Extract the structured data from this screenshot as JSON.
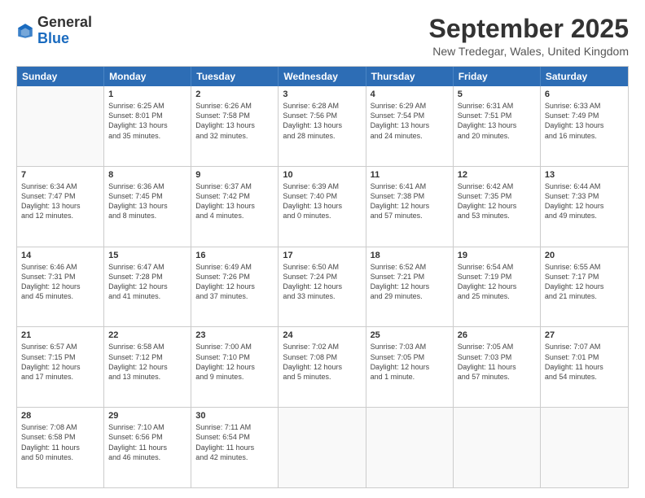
{
  "header": {
    "logo_general": "General",
    "logo_blue": "Blue",
    "month_title": "September 2025",
    "location": "New Tredegar, Wales, United Kingdom"
  },
  "calendar": {
    "days_of_week": [
      "Sunday",
      "Monday",
      "Tuesday",
      "Wednesday",
      "Thursday",
      "Friday",
      "Saturday"
    ],
    "rows": [
      [
        {
          "day": "",
          "lines": []
        },
        {
          "day": "1",
          "lines": [
            "Sunrise: 6:25 AM",
            "Sunset: 8:01 PM",
            "Daylight: 13 hours",
            "and 35 minutes."
          ]
        },
        {
          "day": "2",
          "lines": [
            "Sunrise: 6:26 AM",
            "Sunset: 7:58 PM",
            "Daylight: 13 hours",
            "and 32 minutes."
          ]
        },
        {
          "day": "3",
          "lines": [
            "Sunrise: 6:28 AM",
            "Sunset: 7:56 PM",
            "Daylight: 13 hours",
            "and 28 minutes."
          ]
        },
        {
          "day": "4",
          "lines": [
            "Sunrise: 6:29 AM",
            "Sunset: 7:54 PM",
            "Daylight: 13 hours",
            "and 24 minutes."
          ]
        },
        {
          "day": "5",
          "lines": [
            "Sunrise: 6:31 AM",
            "Sunset: 7:51 PM",
            "Daylight: 13 hours",
            "and 20 minutes."
          ]
        },
        {
          "day": "6",
          "lines": [
            "Sunrise: 6:33 AM",
            "Sunset: 7:49 PM",
            "Daylight: 13 hours",
            "and 16 minutes."
          ]
        }
      ],
      [
        {
          "day": "7",
          "lines": [
            "Sunrise: 6:34 AM",
            "Sunset: 7:47 PM",
            "Daylight: 13 hours",
            "and 12 minutes."
          ]
        },
        {
          "day": "8",
          "lines": [
            "Sunrise: 6:36 AM",
            "Sunset: 7:45 PM",
            "Daylight: 13 hours",
            "and 8 minutes."
          ]
        },
        {
          "day": "9",
          "lines": [
            "Sunrise: 6:37 AM",
            "Sunset: 7:42 PM",
            "Daylight: 13 hours",
            "and 4 minutes."
          ]
        },
        {
          "day": "10",
          "lines": [
            "Sunrise: 6:39 AM",
            "Sunset: 7:40 PM",
            "Daylight: 13 hours",
            "and 0 minutes."
          ]
        },
        {
          "day": "11",
          "lines": [
            "Sunrise: 6:41 AM",
            "Sunset: 7:38 PM",
            "Daylight: 12 hours",
            "and 57 minutes."
          ]
        },
        {
          "day": "12",
          "lines": [
            "Sunrise: 6:42 AM",
            "Sunset: 7:35 PM",
            "Daylight: 12 hours",
            "and 53 minutes."
          ]
        },
        {
          "day": "13",
          "lines": [
            "Sunrise: 6:44 AM",
            "Sunset: 7:33 PM",
            "Daylight: 12 hours",
            "and 49 minutes."
          ]
        }
      ],
      [
        {
          "day": "14",
          "lines": [
            "Sunrise: 6:46 AM",
            "Sunset: 7:31 PM",
            "Daylight: 12 hours",
            "and 45 minutes."
          ]
        },
        {
          "day": "15",
          "lines": [
            "Sunrise: 6:47 AM",
            "Sunset: 7:28 PM",
            "Daylight: 12 hours",
            "and 41 minutes."
          ]
        },
        {
          "day": "16",
          "lines": [
            "Sunrise: 6:49 AM",
            "Sunset: 7:26 PM",
            "Daylight: 12 hours",
            "and 37 minutes."
          ]
        },
        {
          "day": "17",
          "lines": [
            "Sunrise: 6:50 AM",
            "Sunset: 7:24 PM",
            "Daylight: 12 hours",
            "and 33 minutes."
          ]
        },
        {
          "day": "18",
          "lines": [
            "Sunrise: 6:52 AM",
            "Sunset: 7:21 PM",
            "Daylight: 12 hours",
            "and 29 minutes."
          ]
        },
        {
          "day": "19",
          "lines": [
            "Sunrise: 6:54 AM",
            "Sunset: 7:19 PM",
            "Daylight: 12 hours",
            "and 25 minutes."
          ]
        },
        {
          "day": "20",
          "lines": [
            "Sunrise: 6:55 AM",
            "Sunset: 7:17 PM",
            "Daylight: 12 hours",
            "and 21 minutes."
          ]
        }
      ],
      [
        {
          "day": "21",
          "lines": [
            "Sunrise: 6:57 AM",
            "Sunset: 7:15 PM",
            "Daylight: 12 hours",
            "and 17 minutes."
          ]
        },
        {
          "day": "22",
          "lines": [
            "Sunrise: 6:58 AM",
            "Sunset: 7:12 PM",
            "Daylight: 12 hours",
            "and 13 minutes."
          ]
        },
        {
          "day": "23",
          "lines": [
            "Sunrise: 7:00 AM",
            "Sunset: 7:10 PM",
            "Daylight: 12 hours",
            "and 9 minutes."
          ]
        },
        {
          "day": "24",
          "lines": [
            "Sunrise: 7:02 AM",
            "Sunset: 7:08 PM",
            "Daylight: 12 hours",
            "and 5 minutes."
          ]
        },
        {
          "day": "25",
          "lines": [
            "Sunrise: 7:03 AM",
            "Sunset: 7:05 PM",
            "Daylight: 12 hours",
            "and 1 minute."
          ]
        },
        {
          "day": "26",
          "lines": [
            "Sunrise: 7:05 AM",
            "Sunset: 7:03 PM",
            "Daylight: 11 hours",
            "and 57 minutes."
          ]
        },
        {
          "day": "27",
          "lines": [
            "Sunrise: 7:07 AM",
            "Sunset: 7:01 PM",
            "Daylight: 11 hours",
            "and 54 minutes."
          ]
        }
      ],
      [
        {
          "day": "28",
          "lines": [
            "Sunrise: 7:08 AM",
            "Sunset: 6:58 PM",
            "Daylight: 11 hours",
            "and 50 minutes."
          ]
        },
        {
          "day": "29",
          "lines": [
            "Sunrise: 7:10 AM",
            "Sunset: 6:56 PM",
            "Daylight: 11 hours",
            "and 46 minutes."
          ]
        },
        {
          "day": "30",
          "lines": [
            "Sunrise: 7:11 AM",
            "Sunset: 6:54 PM",
            "Daylight: 11 hours",
            "and 42 minutes."
          ]
        },
        {
          "day": "",
          "lines": []
        },
        {
          "day": "",
          "lines": []
        },
        {
          "day": "",
          "lines": []
        },
        {
          "day": "",
          "lines": []
        }
      ]
    ]
  }
}
